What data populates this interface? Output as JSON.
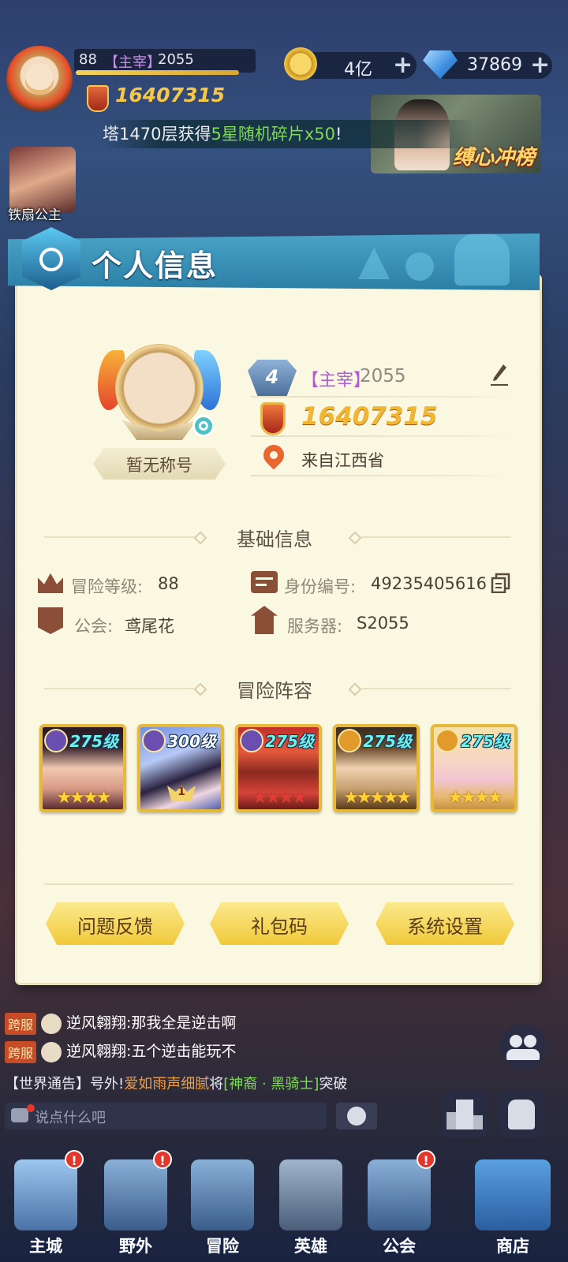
{
  "hud": {
    "level": "88",
    "rank": "【主宰】",
    "server": "2055",
    "level_progress": 0.9,
    "power": "16407315",
    "gold": "4亿",
    "diamonds": "37869",
    "plus": "+"
  },
  "marquee": {
    "prefix": "塔1470层获得",
    "highlight": "5星随机碎片x50",
    "suffix": "!"
  },
  "event_banner": {
    "title": "缚心冲榜"
  },
  "side_hero": {
    "name": "铁扇公主"
  },
  "panel": {
    "title": "个人信息",
    "player_title": "暂无称号",
    "level_badge": "4",
    "rank": "【主宰】",
    "server": "2055",
    "power": "16407315",
    "location": "来自江西省",
    "basic_section": "基础信息",
    "adventure_level_label": "冒险等级:",
    "adventure_level_value": "88",
    "id_label": "身份编号:",
    "id_value": "49235405616",
    "guild_label": "公会:",
    "guild_value": "鸢尾花",
    "server_label": "服务器:",
    "server_value": "S2055",
    "lineup_section": "冒险阵容",
    "heroes": [
      {
        "level": "275级",
        "stars": "★★★★",
        "star_count": 4
      },
      {
        "level": "300级",
        "stars": "",
        "star_count": 0,
        "rank_badge": "1"
      },
      {
        "level": "275级",
        "stars": "★★★★",
        "star_count": 4
      },
      {
        "level": "275级",
        "stars": "★★★★★",
        "star_count": 5
      },
      {
        "level": "275级",
        "stars": "★★★★",
        "star_count": 4
      }
    ],
    "buttons": {
      "feedback": "问题反馈",
      "gift_code": "礼包码",
      "settings": "系统设置"
    }
  },
  "chat": {
    "tag": "跨服",
    "messages": [
      {
        "user": "逆风翱翔:",
        "text": "那我全是逆击啊"
      },
      {
        "user": "逆风翱翔:",
        "text": "五个逆击能玩不"
      }
    ],
    "announcement_prefix": "【世界通告】号外!",
    "announcement_name": "爱如雨声细腻",
    "announcement_mid": "将",
    "announcement_item": "[神裔 · 黑骑士]",
    "announcement_suffix": "突破",
    "input_placeholder": "说点什么吧"
  },
  "nav": [
    {
      "label": "主城",
      "alert": "!"
    },
    {
      "label": "野外",
      "alert": "!"
    },
    {
      "label": "冒险",
      "alert": ""
    },
    {
      "label": "英雄",
      "alert": ""
    },
    {
      "label": "公会",
      "alert": "!"
    },
    {
      "label": "商店",
      "alert": ""
    }
  ],
  "colors": {
    "panel_bg": "#fbf8e1",
    "header_blue": "#2b7fa6",
    "gold": "#f2b630",
    "rank_purple": "#b25bd6",
    "button_yellow": "#f1c93a",
    "hero_level_cyan": "#6ff2e6"
  }
}
